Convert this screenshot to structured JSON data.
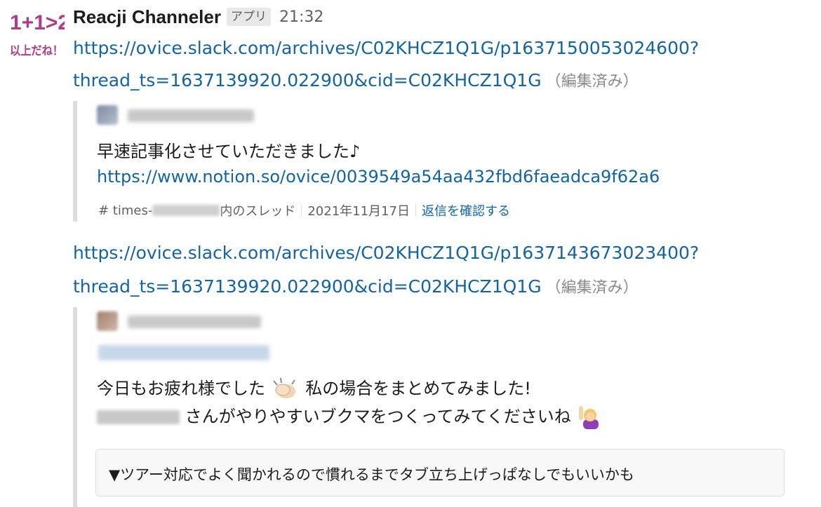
{
  "app": {
    "avatar_text_line1": "1+1>2",
    "avatar_text_line2": "以上だね！",
    "bot_name": "Reacji Channeler",
    "badge": "アプリ",
    "time": "21:32"
  },
  "messages": [
    {
      "link_line1": "https://ovice.slack.com/archives/C02KHCZ1Q1G/p1637150053024600?",
      "link_line2": "thread_ts=1637139920.022900&cid=C02KHCZ1Q1G",
      "edited": "（編集済み）",
      "quote": {
        "text": "早速記事化させていただきました♪",
        "link": "https://www.notion.so/ovice/0039549a54aa432fbd6faeadca9f62a6",
        "channel_prefix": "# times-",
        "channel_suffix": "内のスレッド",
        "date": "2021年11月17日",
        "reply_link": "返信を確認する"
      }
    },
    {
      "link_line1": "https://ovice.slack.com/archives/C02KHCZ1Q1G/p1637143673023400?",
      "link_line2": "thread_ts=1637139920.022900&cid=C02KHCZ1Q1G",
      "edited": "（編集済み）",
      "quote": {
        "line1_a": "今日もお疲れ様でした",
        "line1_b": "私の場合をまとめてみました!",
        "line2": "さんがやりやすいブクマをつくってみてくださいね",
        "details_summary": "▼ツアー対応でよく聞かれるので慣れるまでタブ立ち上げっぱなしでもいいかも"
      }
    }
  ],
  "colors": {
    "link": "#1264a3",
    "quote_bar": "#dddddd",
    "avatar_text": "#b03a8c"
  }
}
